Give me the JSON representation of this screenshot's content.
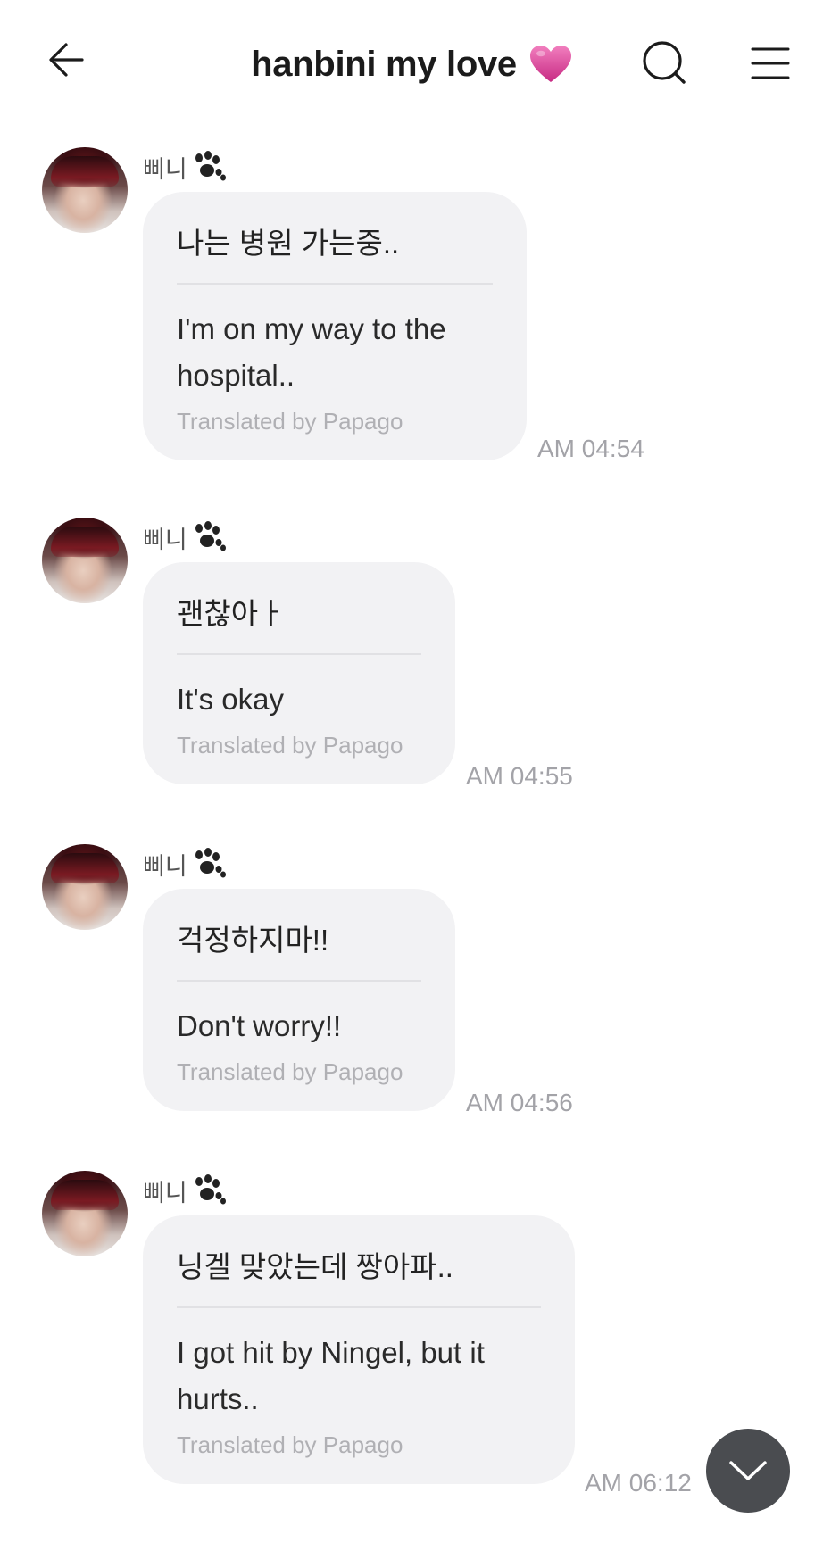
{
  "header": {
    "title": "hanbini my love",
    "title_emoji": "pink-heart",
    "icons": [
      "back-arrow-icon",
      "search-icon",
      "menu-icon"
    ]
  },
  "messages": [
    {
      "sender": "삐니",
      "original": "나는 병원 가는중..",
      "translated": "I'm on my way to the hospital..",
      "credit": "Translated by Papago",
      "time": "AM 04:54"
    },
    {
      "sender": "삐니",
      "original": "괜찮아ㅏ",
      "translated": "It's okay",
      "credit": "Translated by Papago",
      "time": "AM 04:55"
    },
    {
      "sender": "삐니",
      "original": "걱정하지마!!",
      "translated": "Don't worry!!",
      "credit": "Translated by Papago",
      "time": "AM 04:56"
    },
    {
      "sender": "삐니",
      "original": "닝겔 맞았는데 짱아파..",
      "translated": "I got hit by Ningel, but it hurts..",
      "credit": "Translated by Papago",
      "time": "AM 06:12"
    }
  ],
  "colors": {
    "bubble": "#f2f2f4",
    "time": "#a3a3a8",
    "heart": "#e0489b",
    "scroll_button": "#4a4c50"
  }
}
